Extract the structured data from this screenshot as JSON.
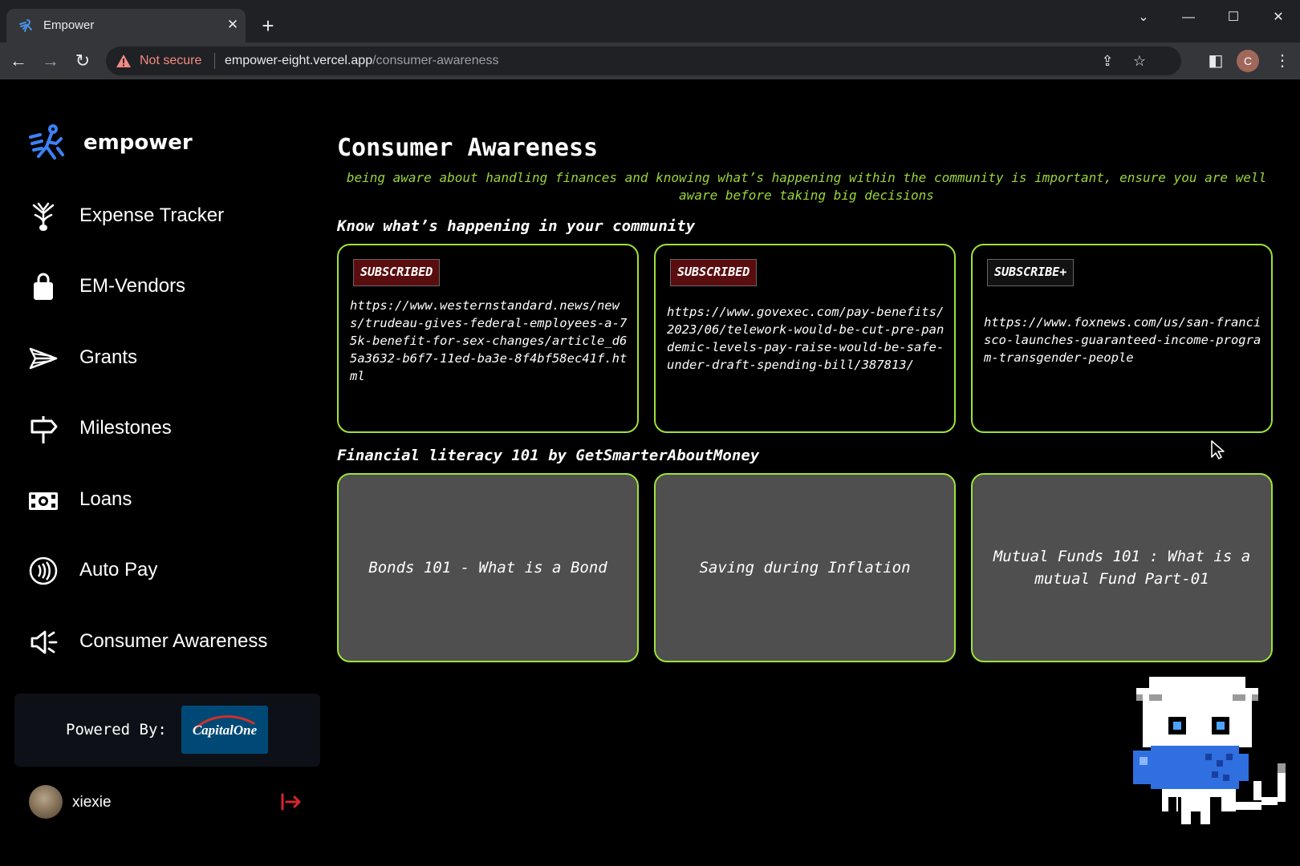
{
  "browser": {
    "tab_title": "Empower",
    "security_label": "Not secure",
    "url_host": "empower-eight.vercel.app",
    "url_path": "/consumer-awareness",
    "profile_initial": "C"
  },
  "sidebar": {
    "brand": "empower",
    "items": [
      {
        "label": "Expense Tracker",
        "icon": "tulip-icon"
      },
      {
        "label": "EM-Vendors",
        "icon": "shopping-bag-icon"
      },
      {
        "label": "Grants",
        "icon": "send-icon"
      },
      {
        "label": "Milestones",
        "icon": "signpost-icon"
      },
      {
        "label": "Loans",
        "icon": "cash-icon"
      },
      {
        "label": "Auto Pay",
        "icon": "contactless-icon"
      },
      {
        "label": "Consumer Awareness",
        "icon": "megaphone-icon"
      }
    ],
    "powered_by": "Powered By:",
    "sponsor": "CapitalOne",
    "user": {
      "name": "xiexie"
    }
  },
  "main": {
    "title": "Consumer Awareness",
    "subtitle": "being aware about handling finances and knowing what’s happening within the community is important, ensure you are well aware before taking big decisions",
    "community_heading": "Know what’s happening in your community",
    "news": [
      {
        "badge": "SUBSCRIBED",
        "url": "https://www.westernstandard.news/news/trudeau-gives-federal-employees-a-75k-benefit-for-sex-changes/article_d65a3632-b6f7-11ed-ba3e-8f4bf58ec41f.html"
      },
      {
        "badge": "SUBSCRIBED",
        "url": "https://www.govexec.com/pay-benefits/2023/06/telework-would-be-cut-pre-pandemic-levels-pay-raise-would-be-safe-under-draft-spending-bill/387813/"
      },
      {
        "badge": "SUBSCRIBE+",
        "url": "https://www.foxnews.com/us/san-francisco-launches-guaranteed-income-program-transgender-people"
      }
    ],
    "literacy_heading": "Financial literacy 101 by GetSmarterAboutMoney",
    "videos": [
      {
        "title": "Bonds 101 - What is a Bond"
      },
      {
        "title": "Saving during Inflation"
      },
      {
        "title": "Mutual Funds 101 : What is a mutual Fund Part-01"
      }
    ]
  },
  "colors": {
    "accent_green": "#9ee23a",
    "subtitle_green": "#9bd63a",
    "subscribed_bg": "#5a0d0f",
    "brand_blue": "#3b82f6",
    "sponsor_blue": "#004977"
  }
}
